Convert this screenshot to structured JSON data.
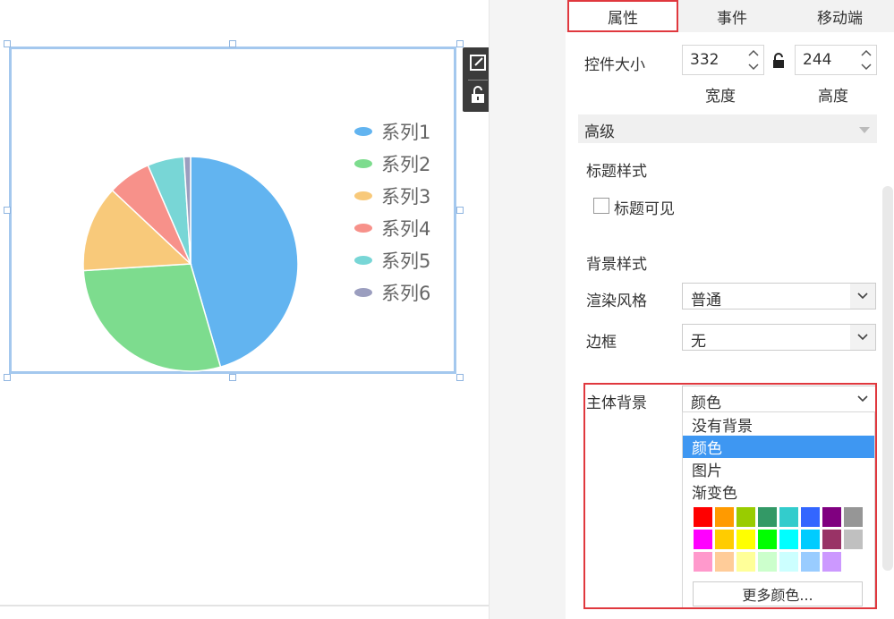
{
  "tabs": [
    {
      "label": "属性",
      "active": true
    },
    {
      "label": "事件",
      "active": false
    },
    {
      "label": "移动端",
      "active": false
    }
  ],
  "size": {
    "label": "控件大小",
    "width": "332",
    "height": "244",
    "width_label": "宽度",
    "height_label": "高度"
  },
  "section_advanced": "高级",
  "title_style": {
    "heading": "标题样式",
    "visible_label": "标题可见",
    "visible_checked": false
  },
  "background_style": {
    "heading": "背景样式",
    "render_label": "渲染风格",
    "render_value": "普通",
    "border_label": "边框",
    "border_value": "无",
    "body_bg_label": "主体背景",
    "body_bg_value": "颜色"
  },
  "dropdown": {
    "options": [
      "没有背景",
      "颜色",
      "图片",
      "渐变色"
    ],
    "selected": "颜色"
  },
  "palette": [
    [
      "#ff0000",
      "#ff9a00",
      "#99cc00",
      "#339966",
      "#33cccc",
      "#3366ff",
      "#800080",
      "#969696"
    ],
    [
      "#ff00ff",
      "#ffcc00",
      "#ffff00",
      "#00ff00",
      "#00ffff",
      "#00ccff",
      "#993366",
      "#c0c0c0"
    ],
    [
      "#ff99cc",
      "#ffcc99",
      "#ffff99",
      "#ccffcc",
      "#ccffff",
      "#99ccff",
      "#cc99ff",
      "#ffffff"
    ]
  ],
  "more_colors": "更多颜色...",
  "chart_data": {
    "type": "pie",
    "series": [
      {
        "name": "系列1",
        "value": 45.5,
        "color": "#62b4f0"
      },
      {
        "name": "系列2",
        "value": 28.5,
        "color": "#7ddc8e"
      },
      {
        "name": "系列3",
        "value": 13.0,
        "color": "#f8c97a"
      },
      {
        "name": "系列4",
        "value": 6.5,
        "color": "#f7918a"
      },
      {
        "name": "系列5",
        "value": 5.5,
        "color": "#78d6d6"
      },
      {
        "name": "系列6",
        "value": 1.0,
        "color": "#9b9ebf"
      }
    ],
    "legend": "right"
  }
}
